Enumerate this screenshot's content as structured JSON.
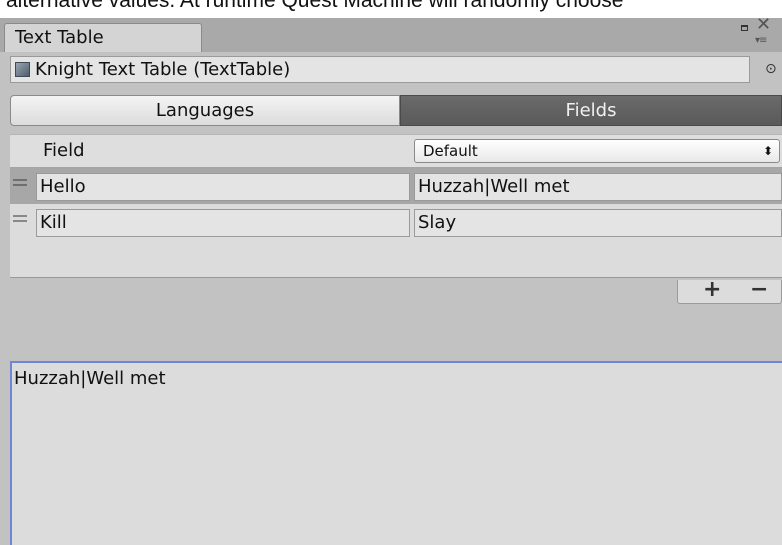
{
  "page_top_text": "alternative values. At runtime Quest Machine will randomly choose",
  "window": {
    "tab_title": "Text Table",
    "icons": [
      "maximize-icon",
      "close-icon",
      "menu-icon"
    ]
  },
  "asset": {
    "name": "Knight Text Table (TextTable)",
    "icon": "text-table-asset-icon",
    "picker_icon": "object-picker-icon"
  },
  "toolbar": {
    "languages_label": "Languages",
    "fields_label": "Fields"
  },
  "table": {
    "field_header": "Field",
    "language_selected": "Default",
    "rows": [
      {
        "field": "Hello",
        "value": "Huzzah|Well met"
      },
      {
        "field": "Kill",
        "value": "Slay"
      }
    ],
    "add_label": "+",
    "remove_label": "−"
  },
  "editor": {
    "text": "Huzzah|Well met"
  }
}
